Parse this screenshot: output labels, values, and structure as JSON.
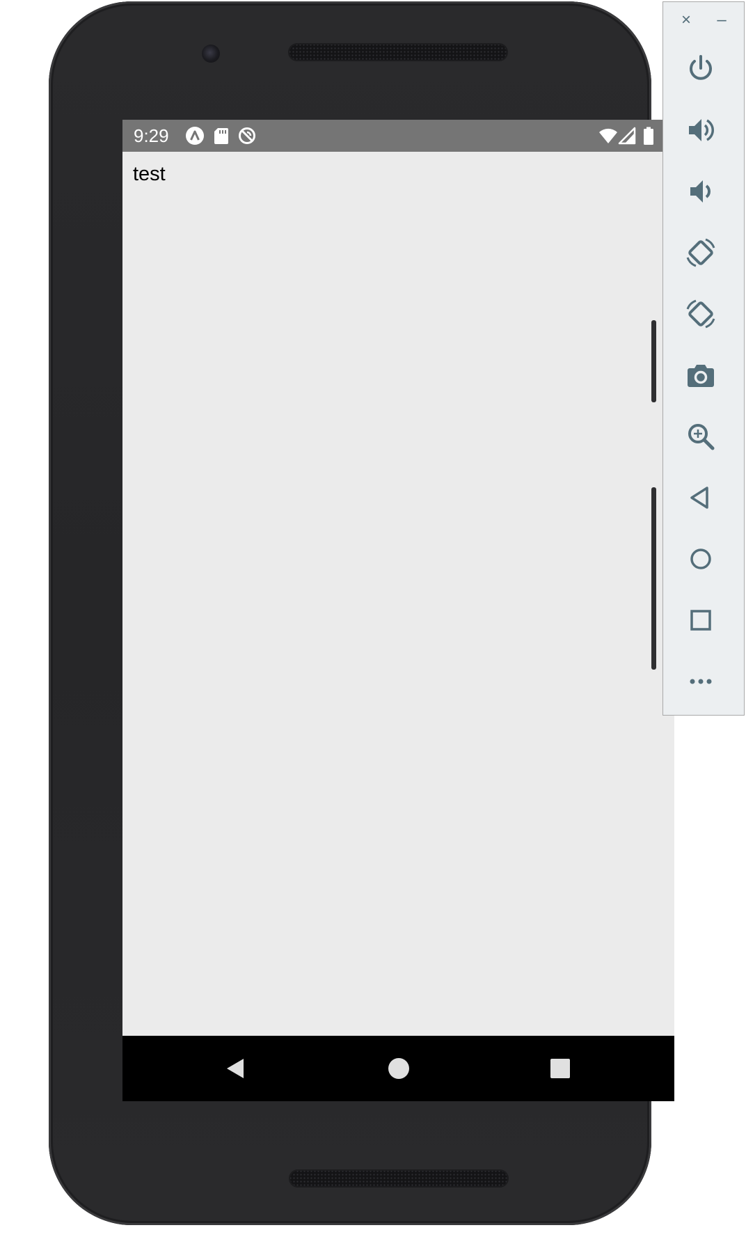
{
  "status_bar": {
    "time": "9:29",
    "icons": [
      "app-notification-icon",
      "sd-card-icon",
      "sync-disabled-icon",
      "wifi-icon",
      "cell-signal-icon",
      "battery-icon"
    ]
  },
  "app": {
    "text": "test"
  },
  "nav_bar": {
    "buttons": [
      "back-icon",
      "home-icon",
      "recents-icon"
    ]
  },
  "emulator_toolbar": {
    "window_controls": {
      "close": "×",
      "minimize": "–"
    },
    "tools": [
      "power-icon",
      "volume-up-icon",
      "volume-down-icon",
      "rotate-left-icon",
      "rotate-right-icon",
      "screenshot-icon",
      "zoom-icon",
      "back-icon",
      "home-icon",
      "overview-icon",
      "more-icon"
    ]
  },
  "colors": {
    "status_bar": "#757575",
    "screen_background": "#ebebeb",
    "nav_bar": "#000000",
    "toolbar_icon": "#546e7a",
    "toolbar_background": "#eceff1",
    "phone_body": "#262628"
  }
}
